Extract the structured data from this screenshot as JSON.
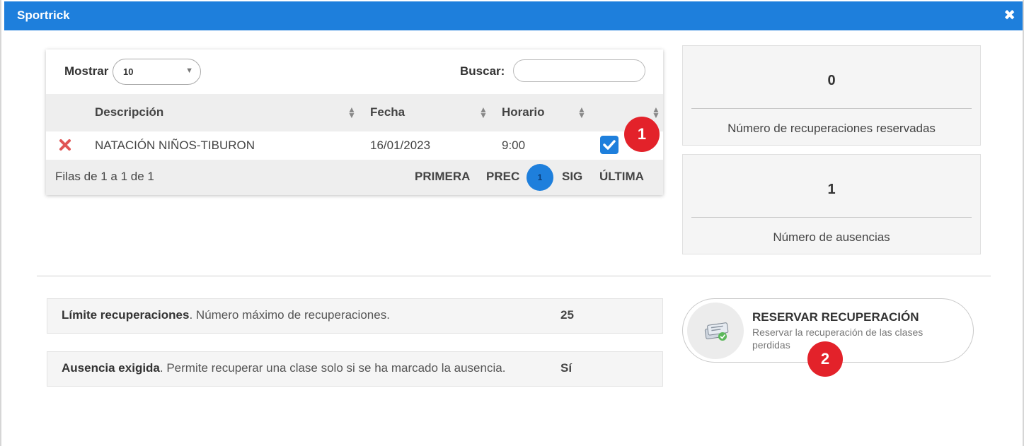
{
  "window": {
    "title": "Sportrick",
    "close_glyph": "✖"
  },
  "table": {
    "show_label": "Mostrar",
    "show_value": "10",
    "search_label": "Buscar:",
    "search_value": "",
    "columns": [
      "Descripción",
      "Fecha",
      "Horario"
    ],
    "rows": [
      {
        "description": "NATACIÓN NIÑOS-TIBURON",
        "date": "16/01/2023",
        "time": "9:00",
        "checked": true
      }
    ],
    "info": "Filas de 1 a 1 de 1",
    "pagination": {
      "first": "PRIMERA",
      "prev": "PREC",
      "current": "1",
      "next": "SIG",
      "last": "ÚLTIMA"
    }
  },
  "badges": {
    "one": "1",
    "two": "2"
  },
  "stats": [
    {
      "value": "0",
      "label": "Número de recuperaciones reservadas"
    },
    {
      "value": "1",
      "label": "Número de ausencias"
    }
  ],
  "info_rows": [
    {
      "title": "Límite recuperaciones",
      "desc": ". Número máximo de recuperaciones.",
      "value": "25"
    },
    {
      "title": "Ausencia exigida",
      "desc": ". Permite recuperar una clase solo si se ha marcado la ausencia.",
      "value": "Sí"
    }
  ],
  "reserve": {
    "title": "RESERVAR RECUPERACIÓN",
    "description": "Reservar la recuperación de las clases perdidas",
    "icon": "tickets-icon"
  },
  "colors": {
    "accent": "#1e7fdc",
    "badge": "#e3222a",
    "delete": "#e05555"
  }
}
